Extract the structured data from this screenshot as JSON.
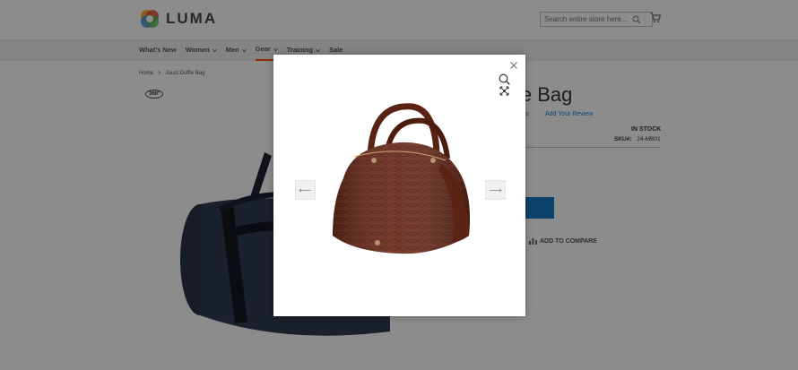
{
  "header": {
    "logo_text": "LUMA",
    "search_placeholder": "Search entire store here...",
    "icons": {
      "search": "search-icon",
      "cart": "cart-icon"
    }
  },
  "nav": {
    "items": [
      {
        "label": "What's New",
        "has_menu": false
      },
      {
        "label": "Women",
        "has_menu": true
      },
      {
        "label": "Men",
        "has_menu": true
      },
      {
        "label": "Gear",
        "has_menu": true,
        "active": true
      },
      {
        "label": "Training",
        "has_menu": true
      },
      {
        "label": "Sale",
        "has_menu": false
      }
    ]
  },
  "breadcrumb": {
    "home": "Home",
    "separator": ">",
    "current": "Joust Duffle Bag"
  },
  "product": {
    "title_visible": "le Bag",
    "reviews_link_left": "s",
    "add_review": "Add Your Review",
    "stock": "IN STOCK",
    "sku_label": "SKU#:",
    "sku_value": "24-MB01",
    "compare": "ADD TO COMPARE",
    "badge_360": "360°"
  },
  "gallery": {
    "close_icon": "close-icon",
    "zoom_icon": "zoom-in-icon",
    "fullscreen_icon": "fullscreen-icon",
    "prev_icon": "arrow-left-icon",
    "next_icon": "arrow-right-icon",
    "image": "brown-croc-handbag"
  },
  "colors": {
    "accent_nav": "#ff5501",
    "link": "#1979c3",
    "bag_brown": "#6b2a1a"
  }
}
